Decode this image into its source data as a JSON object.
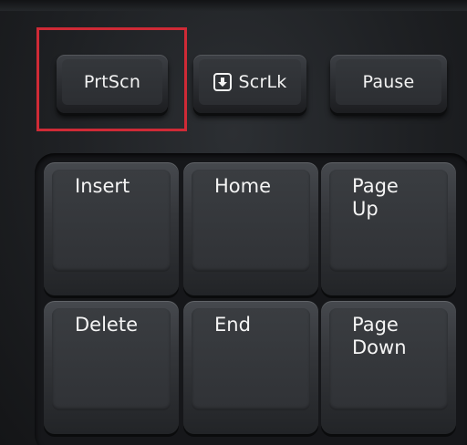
{
  "function_row": {
    "prtscn_label": "PrtScn",
    "scrlk_label": "ScrLk",
    "scrlk_icon": "down-arrow-box-icon",
    "pause_label": "Pause"
  },
  "highlight_color": "#cf2a36",
  "nav_keys": {
    "insert": "Insert",
    "home": "Home",
    "page_up": "Page\nUp",
    "delete": "Delete",
    "end": "End",
    "page_down": "Page\nDown"
  }
}
